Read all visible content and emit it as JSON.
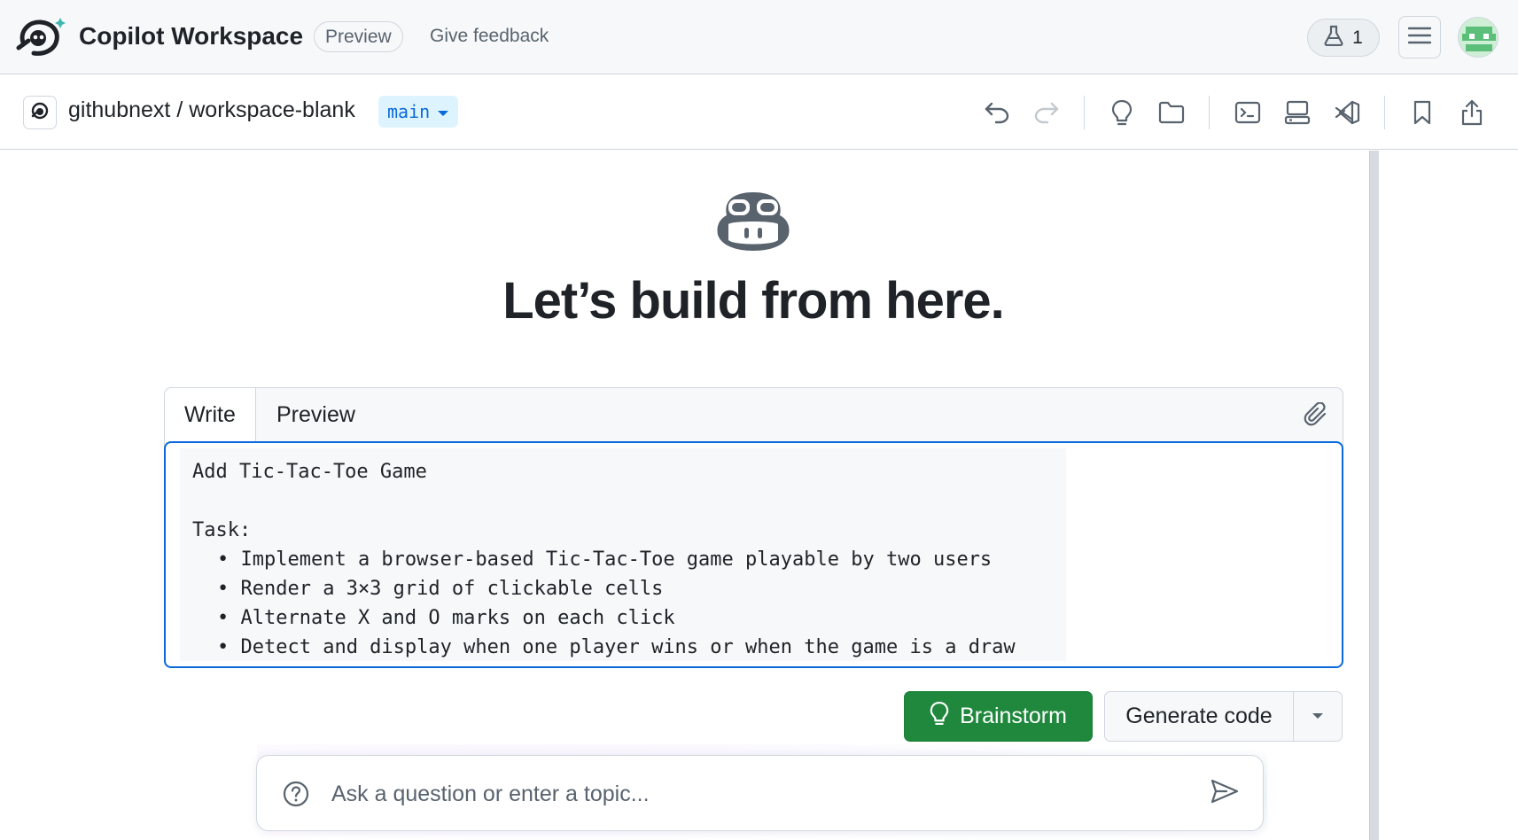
{
  "header": {
    "app_title": "Copilot Workspace",
    "preview_badge": "Preview",
    "feedback_link": "Give feedback",
    "lab_count": "1"
  },
  "repo": {
    "owner": "githubnext",
    "separator": "/",
    "name": "workspace-blank",
    "branch": "main"
  },
  "main": {
    "headline": "Let’s build from here."
  },
  "editor": {
    "tabs": [
      {
        "label": "Write"
      },
      {
        "label": "Preview"
      }
    ],
    "lines": [
      "Add Tic-Tac-Toe Game",
      "",
      "Task:",
      "• Implement a browser-based Tic-Tac-Toe game playable by two users",
      "• Render a 3×3 grid of clickable cells",
      "• Alternate X and O marks on each click",
      "• Detect and display when one player wins or when the game is a draw"
    ]
  },
  "actions": {
    "brainstorm_label": "Brainstorm",
    "generate_label": "Generate code"
  },
  "ask": {
    "placeholder": "Ask a question or enter a topic..."
  },
  "colors": {
    "accent_blue": "#0969da",
    "primary_green": "#1f883d",
    "header_bg": "#f6f8fa",
    "text_primary": "#1f2328",
    "text_muted": "#59636e"
  }
}
